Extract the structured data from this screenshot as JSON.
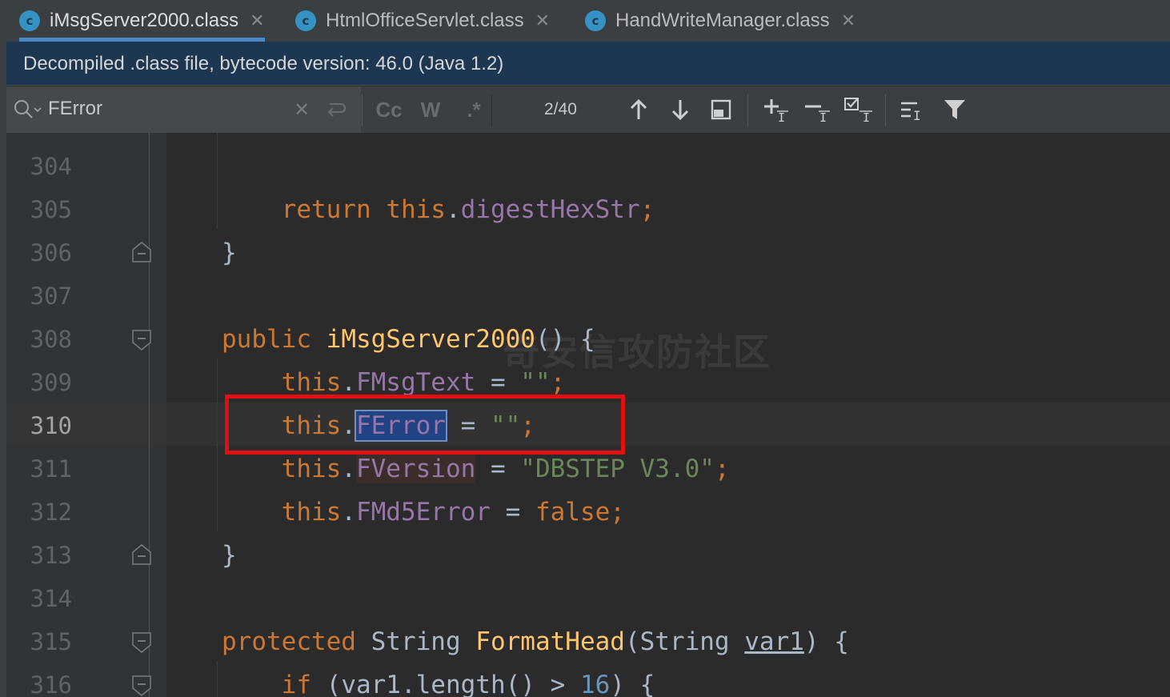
{
  "tabs": [
    {
      "label": "iMsgServer2000.class",
      "icon": "class-icon",
      "active": true
    },
    {
      "label": "HtmlOfficeServlet.class",
      "icon": "class-icon",
      "active": false
    },
    {
      "label": "HandWriteManager.class",
      "icon": "class-icon",
      "active": false
    }
  ],
  "tab_icon_letter": "c",
  "banner": {
    "text": "Decompiled .class file, bytecode version: 46.0 (Java 1.2)"
  },
  "search": {
    "value": "FError",
    "match_case_label": "Cc",
    "words_label": "W",
    "regex_label": ".*",
    "counter": "2/40"
  },
  "editor": {
    "line_numbers": [
      "304",
      "305",
      "306",
      "307",
      "308",
      "309",
      "310",
      "311",
      "312",
      "313",
      "314",
      "315",
      "316"
    ],
    "current_line": "310"
  },
  "watermark": "奇安信攻防社区",
  "colors": {
    "keyword": "#cc7832",
    "field": "#9876aa",
    "string": "#6a8759",
    "method": "#ffc66d",
    "number": "#6897bb",
    "text": "#a9b7c6",
    "highlight": "#e01010"
  }
}
